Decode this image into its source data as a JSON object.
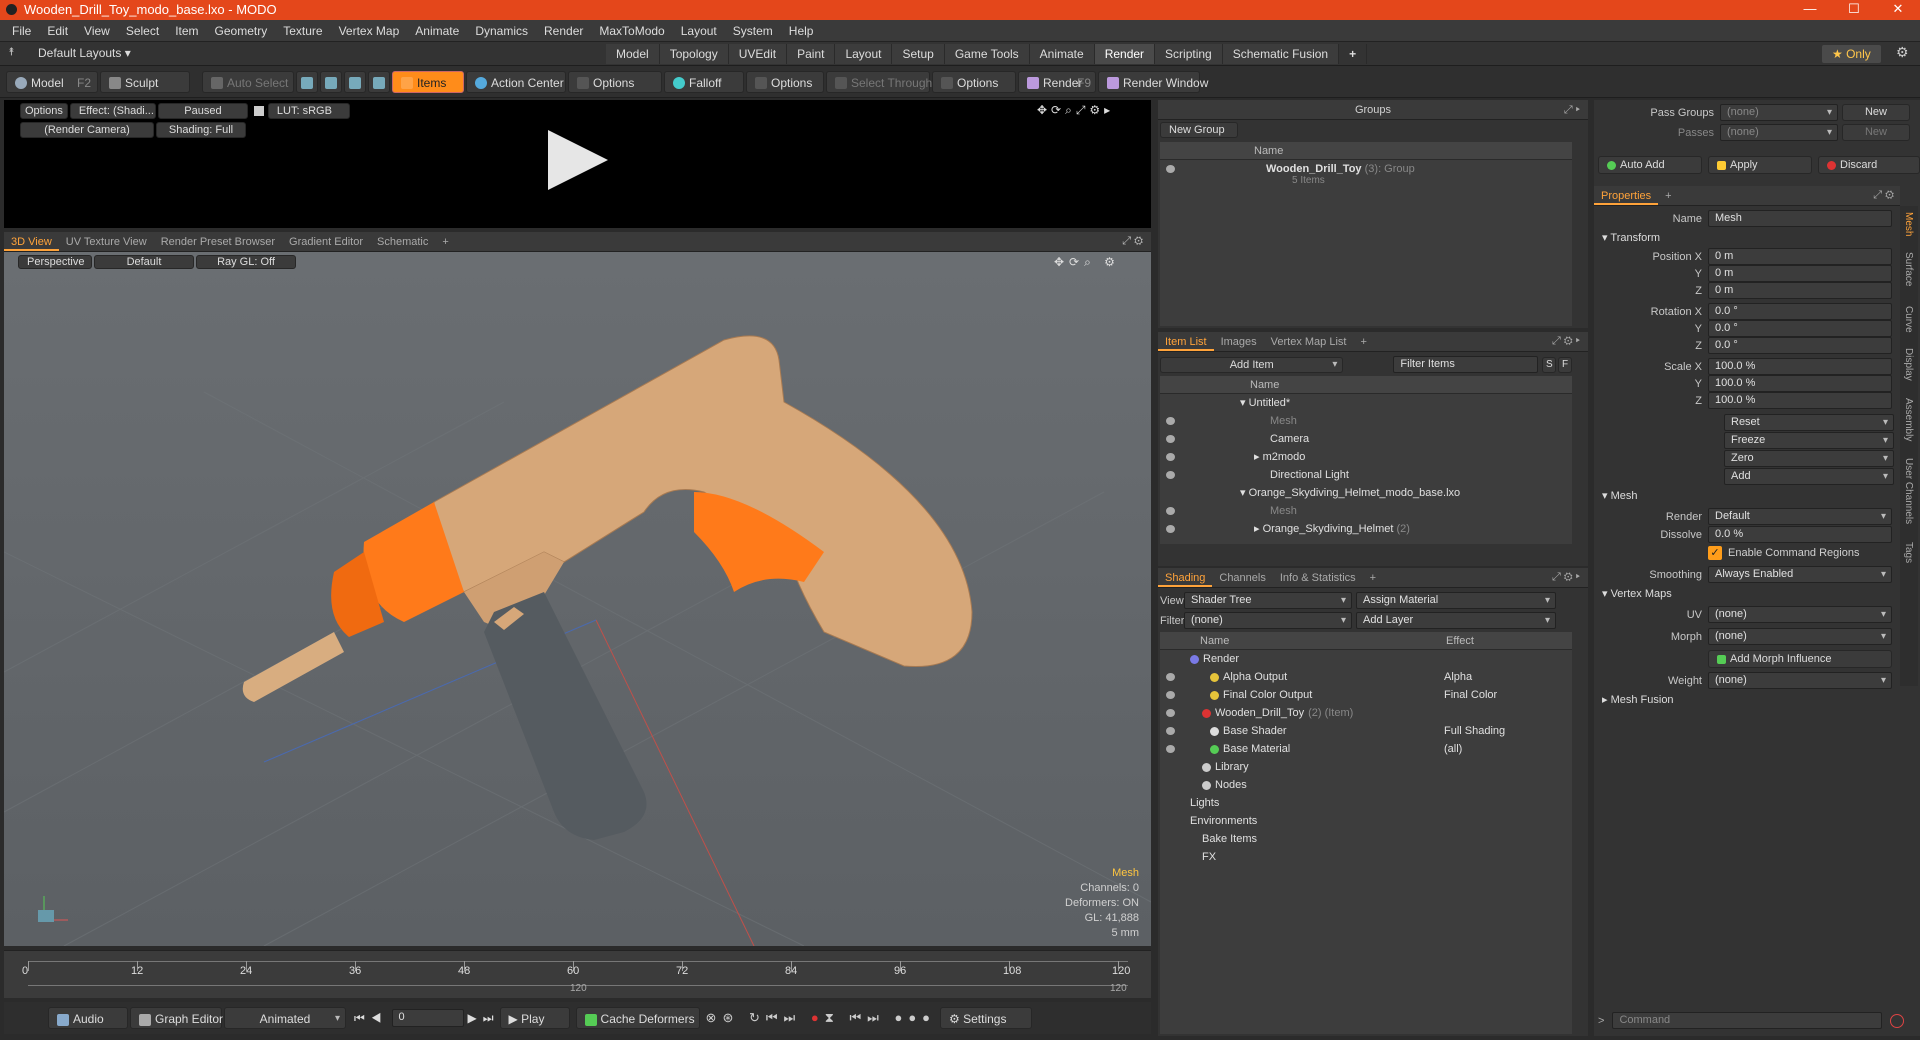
{
  "window": {
    "title": "Wooden_Drill_Toy_modo_base.lxo - MODO",
    "controls": [
      "—",
      "☐",
      "✕"
    ]
  },
  "menu": [
    "File",
    "Edit",
    "View",
    "Select",
    "Item",
    "Geometry",
    "Texture",
    "Vertex Map",
    "Animate",
    "Dynamics",
    "Render",
    "MaxToModo",
    "Layout",
    "System",
    "Help"
  ],
  "layouts": {
    "dropdown": "Default Layouts ▾",
    "tabs": [
      "Model",
      "Topology",
      "UVEdit",
      "Paint",
      "Layout",
      "Setup",
      "Game Tools",
      "Animate",
      "Render",
      "Scripting",
      "Schematic Fusion",
      "+"
    ],
    "active": "Render",
    "only": "★ Only"
  },
  "toolbar": {
    "model": "Model",
    "model_key": "F2",
    "sculpt": "Sculpt",
    "auto_select": "Auto Select",
    "items": "Items",
    "action_center": "Action Center",
    "options1": "Options",
    "falloff": "Falloff",
    "options2": "Options",
    "select_through": "Select Through",
    "options3": "Options",
    "render": "Render",
    "render_key": "F9",
    "render_window": "Render Window"
  },
  "render_preview": {
    "options": "Options",
    "effect": "Effect: (Shadi...",
    "paused": "Paused",
    "lut": "LUT: sRGB",
    "camera": "(Render Camera)",
    "shading": "Shading: Full"
  },
  "viewport": {
    "tabs": [
      "3D View",
      "UV Texture View",
      "Render Preset Browser",
      "Gradient Editor",
      "Schematic",
      "+"
    ],
    "perspective": "Perspective",
    "default": "Default",
    "raygl": "Ray GL: Off",
    "info": {
      "type": "Mesh",
      "channels": "Channels: 0",
      "deformers": "Deformers: ON",
      "gl": "GL: 41,888",
      "scale": "5 mm"
    }
  },
  "timeline": {
    "ticks": [
      "0",
      "12",
      "24",
      "36",
      "48",
      "60",
      "72",
      "84",
      "96",
      "108",
      "120"
    ],
    "sub": "120",
    "sub_end": "120"
  },
  "bottombar": {
    "audio": "Audio",
    "graph_editor": "Graph Editor",
    "animated": "Animated",
    "frame": "0",
    "play": "Play",
    "cache": "Cache Deformers",
    "settings": "Settings"
  },
  "groups": {
    "title": "Groups",
    "new_group": "New Group",
    "col_name": "Name",
    "item": "Wooden_Drill_Toy",
    "item_count": "(3)",
    "item_type": ": Group",
    "item_sub": "5 Items"
  },
  "itemlist": {
    "tabs": [
      "Item List",
      "Images",
      "Vertex Map List",
      "+"
    ],
    "add_item": "Add Item",
    "filter": "Filter Items",
    "s": "S",
    "f": "F",
    "col_name": "Name",
    "rows": [
      {
        "label": "Untitled*",
        "dim": false
      },
      {
        "label": "Mesh",
        "dim": true
      },
      {
        "label": "Camera",
        "dim": false
      },
      {
        "label": "m2modo",
        "dim": false
      },
      {
        "label": "Directional Light",
        "dim": false
      },
      {
        "label": "Orange_Skydiving_Helmet_modo_base.lxo",
        "dim": false
      },
      {
        "label": "Mesh",
        "dim": true
      },
      {
        "label": "Orange_Skydiving_Helmet",
        "dim": false,
        "extra": "(2)"
      }
    ]
  },
  "shading": {
    "tabs": [
      "Shading",
      "Channels",
      "Info & Statistics",
      "+"
    ],
    "view_label": "View",
    "view": "Shader Tree",
    "assign": "Assign Material",
    "filter_label": "Filter",
    "filter": "(none)",
    "add_layer": "Add Layer",
    "col_name": "Name",
    "col_effect": "Effect",
    "rows": [
      {
        "label": "Render",
        "effect": ""
      },
      {
        "label": "Alpha Output",
        "effect": "Alpha"
      },
      {
        "label": "Final Color Output",
        "effect": "Final Color"
      },
      {
        "label": "Wooden_Drill_Toy",
        "extra": "(2) (Item)",
        "effect": ""
      },
      {
        "label": "Base Shader",
        "effect": "Full Shading"
      },
      {
        "label": "Base Material",
        "effect": "(all)"
      },
      {
        "label": "Library",
        "effect": ""
      },
      {
        "label": "Nodes",
        "effect": ""
      },
      {
        "label": "Lights",
        "effect": ""
      },
      {
        "label": "Environments",
        "effect": ""
      },
      {
        "label": "Bake Items",
        "effect": ""
      },
      {
        "label": "FX",
        "effect": ""
      }
    ]
  },
  "props": {
    "pass_groups_label": "Pass Groups",
    "pass_groups": "(none)",
    "new": "New",
    "passes_label": "Passes",
    "passes": "(none)",
    "new2": "New",
    "auto_add": "Auto Add",
    "apply": "Apply",
    "discard": "Discard",
    "tab": "Properties",
    "name_label": "Name",
    "name": "Mesh",
    "transform": "Transform",
    "pos_label": "Position X",
    "rot_label": "Rotation X",
    "scale_label": "Scale X",
    "y": "Y",
    "z": "Z",
    "pos": [
      "0 m",
      "0 m",
      "0 m"
    ],
    "rot": [
      "0.0 °",
      "0.0 °",
      "0.0 °"
    ],
    "scl": [
      "100.0 %",
      "100.0 %",
      "100.0 %"
    ],
    "reset": "Reset",
    "freeze": "Freeze",
    "zero": "Zero",
    "add": "Add",
    "mesh": "Mesh",
    "render_label": "Render",
    "render": "Default",
    "dissolve_label": "Dissolve",
    "dissolve": "0.0 %",
    "enable_cmd": "Enable Command Regions",
    "smoothing_label": "Smoothing",
    "smoothing": "Always Enabled",
    "vertex_maps": "Vertex Maps",
    "uv_label": "UV",
    "uv": "(none)",
    "morph_label": "Morph",
    "morph": "(none)",
    "add_morph": "Add Morph Influence",
    "weight_label": "Weight",
    "weight": "(none)",
    "mesh_fusion": "Mesh Fusion",
    "command": "Command",
    "side_tabs": [
      "Mesh",
      "Surface",
      "Curve",
      "Display",
      "Assembly",
      "User Channels",
      "Tags"
    ]
  }
}
